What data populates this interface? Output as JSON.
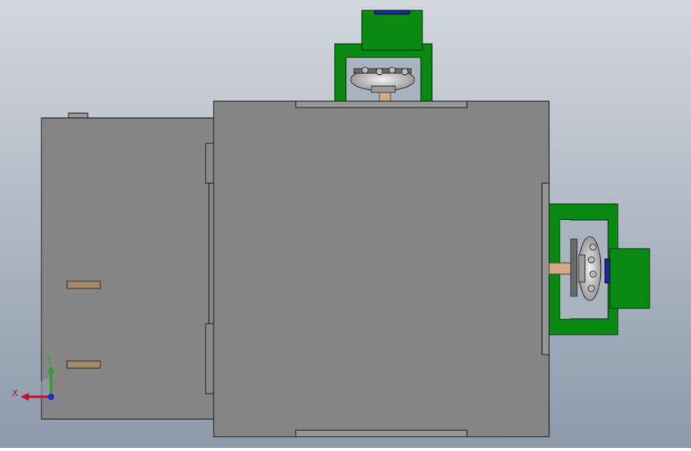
{
  "viewport": {
    "background_top": "#d2d7de",
    "background_bottom": "#8d9aaa"
  },
  "colors": {
    "housing_gray": "#858585",
    "housing_stroke": "#1a1a1a",
    "motor_green": "#0a8a12",
    "motor_green_dark": "#056a0b",
    "shaft_copper": "#d4a98a",
    "coupling_silver": "#c8c8c8",
    "slot_tan": "#a08a6a",
    "axis_x": "#c8102e",
    "axis_y": "#2aa02a",
    "axis_z": "#1a2ad0"
  },
  "triad": {
    "x_label": "X",
    "y_label": "Y",
    "icon": "coordinate-triad-icon"
  }
}
